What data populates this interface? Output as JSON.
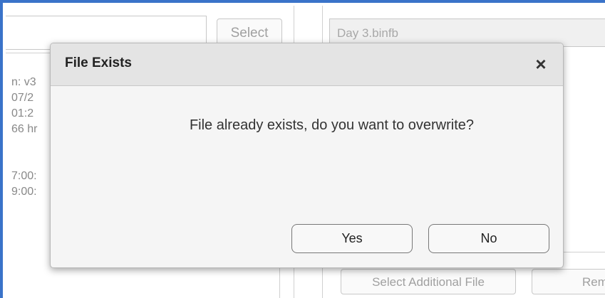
{
  "background": {
    "select_label": "Select",
    "file_name": "Day 3.binfb",
    "info_lines": [
      "n: v3",
      "07/2",
      "01:2",
      "66 hr",
      "",
      "7:00:",
      "9:00:"
    ],
    "select_additional_label": "Select Additional File",
    "remove_label": "Remo"
  },
  "dialog": {
    "title": "File Exists",
    "close_icon": "×",
    "message": "File already exists, do you want to overwrite?",
    "yes_label": "Yes",
    "no_label": "No"
  },
  "colors": {
    "accent_border": "#3a73c9"
  }
}
